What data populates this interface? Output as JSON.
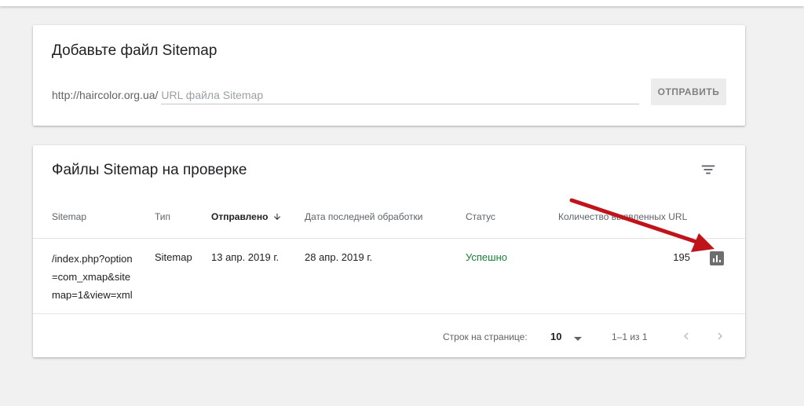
{
  "add_card": {
    "title": "Добавьте файл Sitemap",
    "url_prefix": "http://haircolor.org.ua/",
    "input_placeholder": "URL файла Sitemap",
    "input_value": "",
    "submit_label": "ОТПРАВИТЬ"
  },
  "list_card": {
    "title": "Файлы Sitemap на проверке",
    "filter_icon": "filter-list-icon",
    "columns": {
      "sitemap": "Sitemap",
      "type": "Тип",
      "submitted": "Отправлено",
      "last_read": "Дата последней обработки",
      "status": "Статус",
      "discovered": "Количество выявленных URL"
    },
    "sort_icon": "arrow-down-icon",
    "rows": [
      {
        "sitemap": "/index.php?option=com_xmap&sitemap=1&view=xml",
        "type": "Sitemap",
        "submitted": "13 апр. 2019 г.",
        "last_read": "28 апр. 2019 г.",
        "status": "Успешно",
        "discovered": "195",
        "report_icon": "bar-chart-icon"
      }
    ],
    "pagination": {
      "rows_per_page_label": "Строк на странице:",
      "rows_per_page_value": "10",
      "range_label": "1–1 из 1"
    }
  },
  "colors": {
    "status_success": "#188038",
    "annotation_arrow": "#c0141b",
    "report_icon_bg": "#6e6e6e"
  }
}
